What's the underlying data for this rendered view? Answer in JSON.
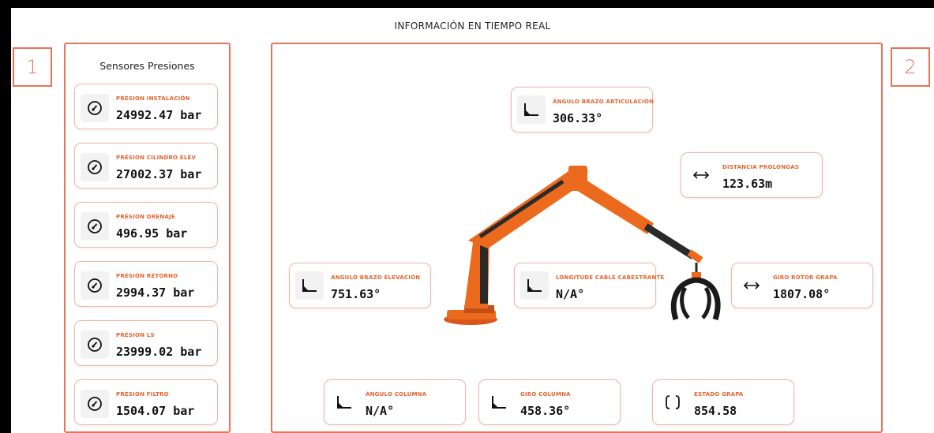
{
  "header": {
    "title": "INFORMACIÓN EN TIEMPO REAL"
  },
  "markers": {
    "left": "1",
    "right": "2"
  },
  "sensors": {
    "title": "Sensores Presiones",
    "items": [
      {
        "label": "PRÉSION INSTALACIÓN",
        "value": "24992.47 bar",
        "icon": "gauge-icon"
      },
      {
        "label": "PRÉSION CILINDRO ELEV",
        "value": "27002.37 bar",
        "icon": "gauge-icon"
      },
      {
        "label": "PRÉSION DRENAJE",
        "value": "496.95 bar",
        "icon": "gauge-icon"
      },
      {
        "label": "PRÉSION RETORNO",
        "value": "2994.37 bar",
        "icon": "gauge-icon"
      },
      {
        "label": "PRÉSION LS",
        "value": "23999.02 bar",
        "icon": "gauge-icon"
      },
      {
        "label": "PRÉSION FILTRO",
        "value": "1504.07 bar",
        "icon": "gauge-icon"
      }
    ]
  },
  "positions": {
    "angulo_brazo_articulacion": {
      "label": "ÁNGULO BRAZO ARTICULACIÓN",
      "value": "306.33°",
      "icon": "angle-icon"
    },
    "distancia_prolongas": {
      "label": "DISTANCIA PROLONGAS",
      "value": "123.63m",
      "icon": "horizontal-arrows-icon"
    },
    "angulo_brazo_elevacion": {
      "label": "ÁNGULO BRAZO ELEVACIÓN",
      "value": "751.63°",
      "icon": "angle-icon"
    },
    "longitude_cable": {
      "label": "LONGITUDE CABLE CABESTRANTE",
      "value": "N/A°",
      "icon": "angle-icon"
    },
    "giro_rotor_grapa": {
      "label": "GIRO ROTOR GRAPA",
      "value": "1807.08°",
      "icon": "horizontal-arrows-icon"
    },
    "angulo_columna": {
      "label": "ÁNGULO COLUMNA",
      "value": "N/A°",
      "icon": "angle-icon"
    },
    "giro_columna": {
      "label": "GIRO COLUMNA",
      "value": "458.36°",
      "icon": "angle-icon"
    },
    "estado_grapa": {
      "label": "ESTADO GRAPA",
      "value": "854.58",
      "icon": "bracket-icon"
    }
  },
  "colors": {
    "accent": "#e8735a",
    "label": "#e8622d",
    "crane": "#ec6a1e"
  }
}
